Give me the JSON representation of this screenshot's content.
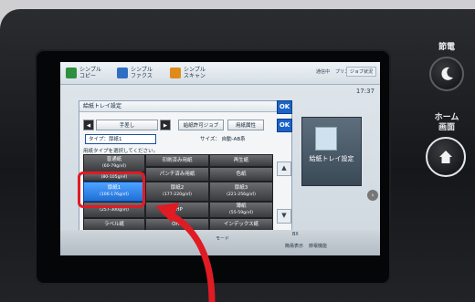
{
  "top_tabs": [
    {
      "label_line1": "シンプル",
      "label_line2": "コピー",
      "icon": "copy-icon",
      "color": "#2e8f3e"
    },
    {
      "label_line1": "シンプル",
      "label_line2": "ファクス",
      "icon": "fax-icon",
      "color": "#2f6fc2"
    },
    {
      "label_line1": "シンプル",
      "label_line2": "スキャン",
      "icon": "scan-icon",
      "color": "#e08a1a"
    }
  ],
  "status": {
    "left": "通信中",
    "right": "プリンター",
    "job_button": "ジョブ状況"
  },
  "clock": "17:37",
  "dialog": {
    "title": "給紙トレイ設定",
    "ok_label": "OK",
    "tray": "手差し",
    "tray_prev": "◀",
    "tray_next": "▶",
    "job_button": "給紙許可ジョブ",
    "attr_button": "用紙属性",
    "type_label": "タイプ：",
    "type_value": "厚紙1",
    "size_label": "サイズ：",
    "size_value": "自動-AB系",
    "instruction": "用紙タイプを選択してください。",
    "paper_types": [
      {
        "name": "普通紙",
        "sub": "(60-79g/㎡)"
      },
      {
        "name": "印刷済み用紙",
        "sub": ""
      },
      {
        "name": "再生紙",
        "sub": ""
      },
      {
        "name": "普通紙2",
        "sub": "(80-105g/㎡)"
      },
      {
        "name": "パンチ済み用紙",
        "sub": ""
      },
      {
        "name": "色紙",
        "sub": ""
      },
      {
        "name": "厚紙1",
        "sub": "(106-176g/㎡)"
      },
      {
        "name": "厚紙2",
        "sub": "(177-220g/㎡)"
      },
      {
        "name": "厚紙3",
        "sub": "(221-256g/㎡)"
      },
      {
        "name": "厚紙4",
        "sub": "(257-300g/㎡)"
      },
      {
        "name": "OHP",
        "sub": ""
      },
      {
        "name": "薄紙",
        "sub": "(55-59g/㎡)"
      },
      {
        "name": "ラベル紙",
        "sub": ""
      },
      {
        "name": "OHP",
        "sub": ""
      },
      {
        "name": "インデックス紙",
        "sub": ""
      }
    ]
  },
  "right_panel": {
    "label": "給紙トレイ設定",
    "small_icon_label": "Ex"
  },
  "bottom_bar": [
    "モード",
    "BX",
    "簡易表示",
    "節電機能"
  ],
  "hardware": {
    "power_label": "節電",
    "home_label_1": "ホーム",
    "home_label_2": "画面"
  },
  "accent": "#1c63c6",
  "annotation_color": "#e01b24"
}
